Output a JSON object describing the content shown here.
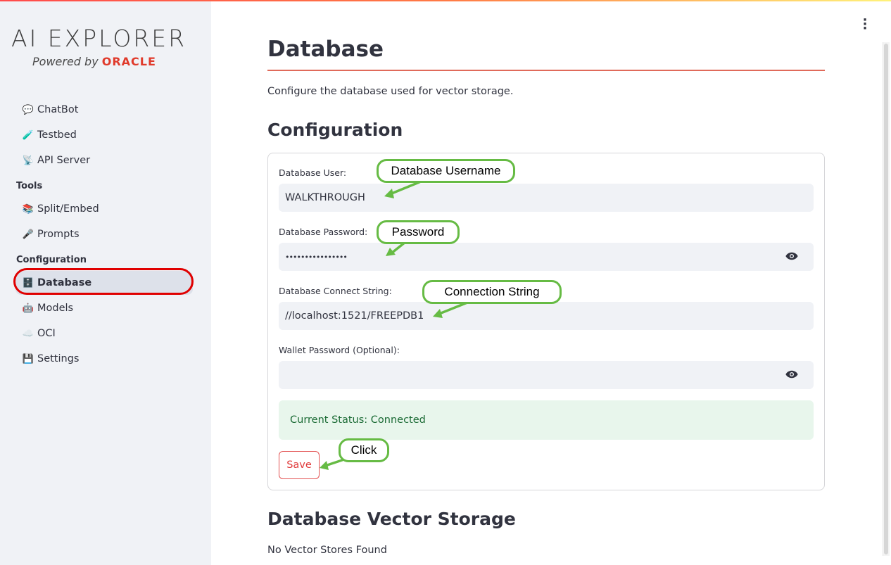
{
  "sidebar": {
    "logo_title": "AI EXPLORER",
    "logo_powered": "Powered by ",
    "logo_brand": "ORACLE",
    "items": [
      {
        "label": "ChatBot",
        "icon": "💬"
      },
      {
        "label": "Testbed",
        "icon": "🧪"
      },
      {
        "label": "API Server",
        "icon": "📡"
      }
    ],
    "tools_header": "Tools",
    "tools": [
      {
        "label": "Split/Embed",
        "icon": "📚"
      },
      {
        "label": "Prompts",
        "icon": "🎤"
      }
    ],
    "config_header": "Configuration",
    "config": [
      {
        "label": "Database",
        "icon": "🗄️"
      },
      {
        "label": "Models",
        "icon": "🤖"
      },
      {
        "label": "OCI",
        "icon": "☁️"
      },
      {
        "label": "Settings",
        "icon": "💾"
      }
    ]
  },
  "main": {
    "title": "Database",
    "intro": "Configure the database used for vector storage.",
    "config_title": "Configuration",
    "user_label": "Database User:",
    "user_value": "WALKTHROUGH",
    "password_label": "Database Password:",
    "password_value": "••••••••••••••••",
    "connect_label": "Database Connect String:",
    "connect_value": "//localhost:1521/FREEPDB1",
    "wallet_label": "Wallet Password (Optional):",
    "wallet_value": "",
    "status": "Current Status: Connected",
    "save_label": "Save",
    "vector_title": "Database Vector Storage",
    "vector_empty": "No Vector Stores Found"
  },
  "callouts": {
    "username": "Database Username",
    "password": "Password",
    "connect": "Connection String",
    "click": "Click"
  },
  "colors": {
    "accent": "#ff4b4b",
    "callout_border": "#66bb44",
    "highlight": "#e00000"
  }
}
